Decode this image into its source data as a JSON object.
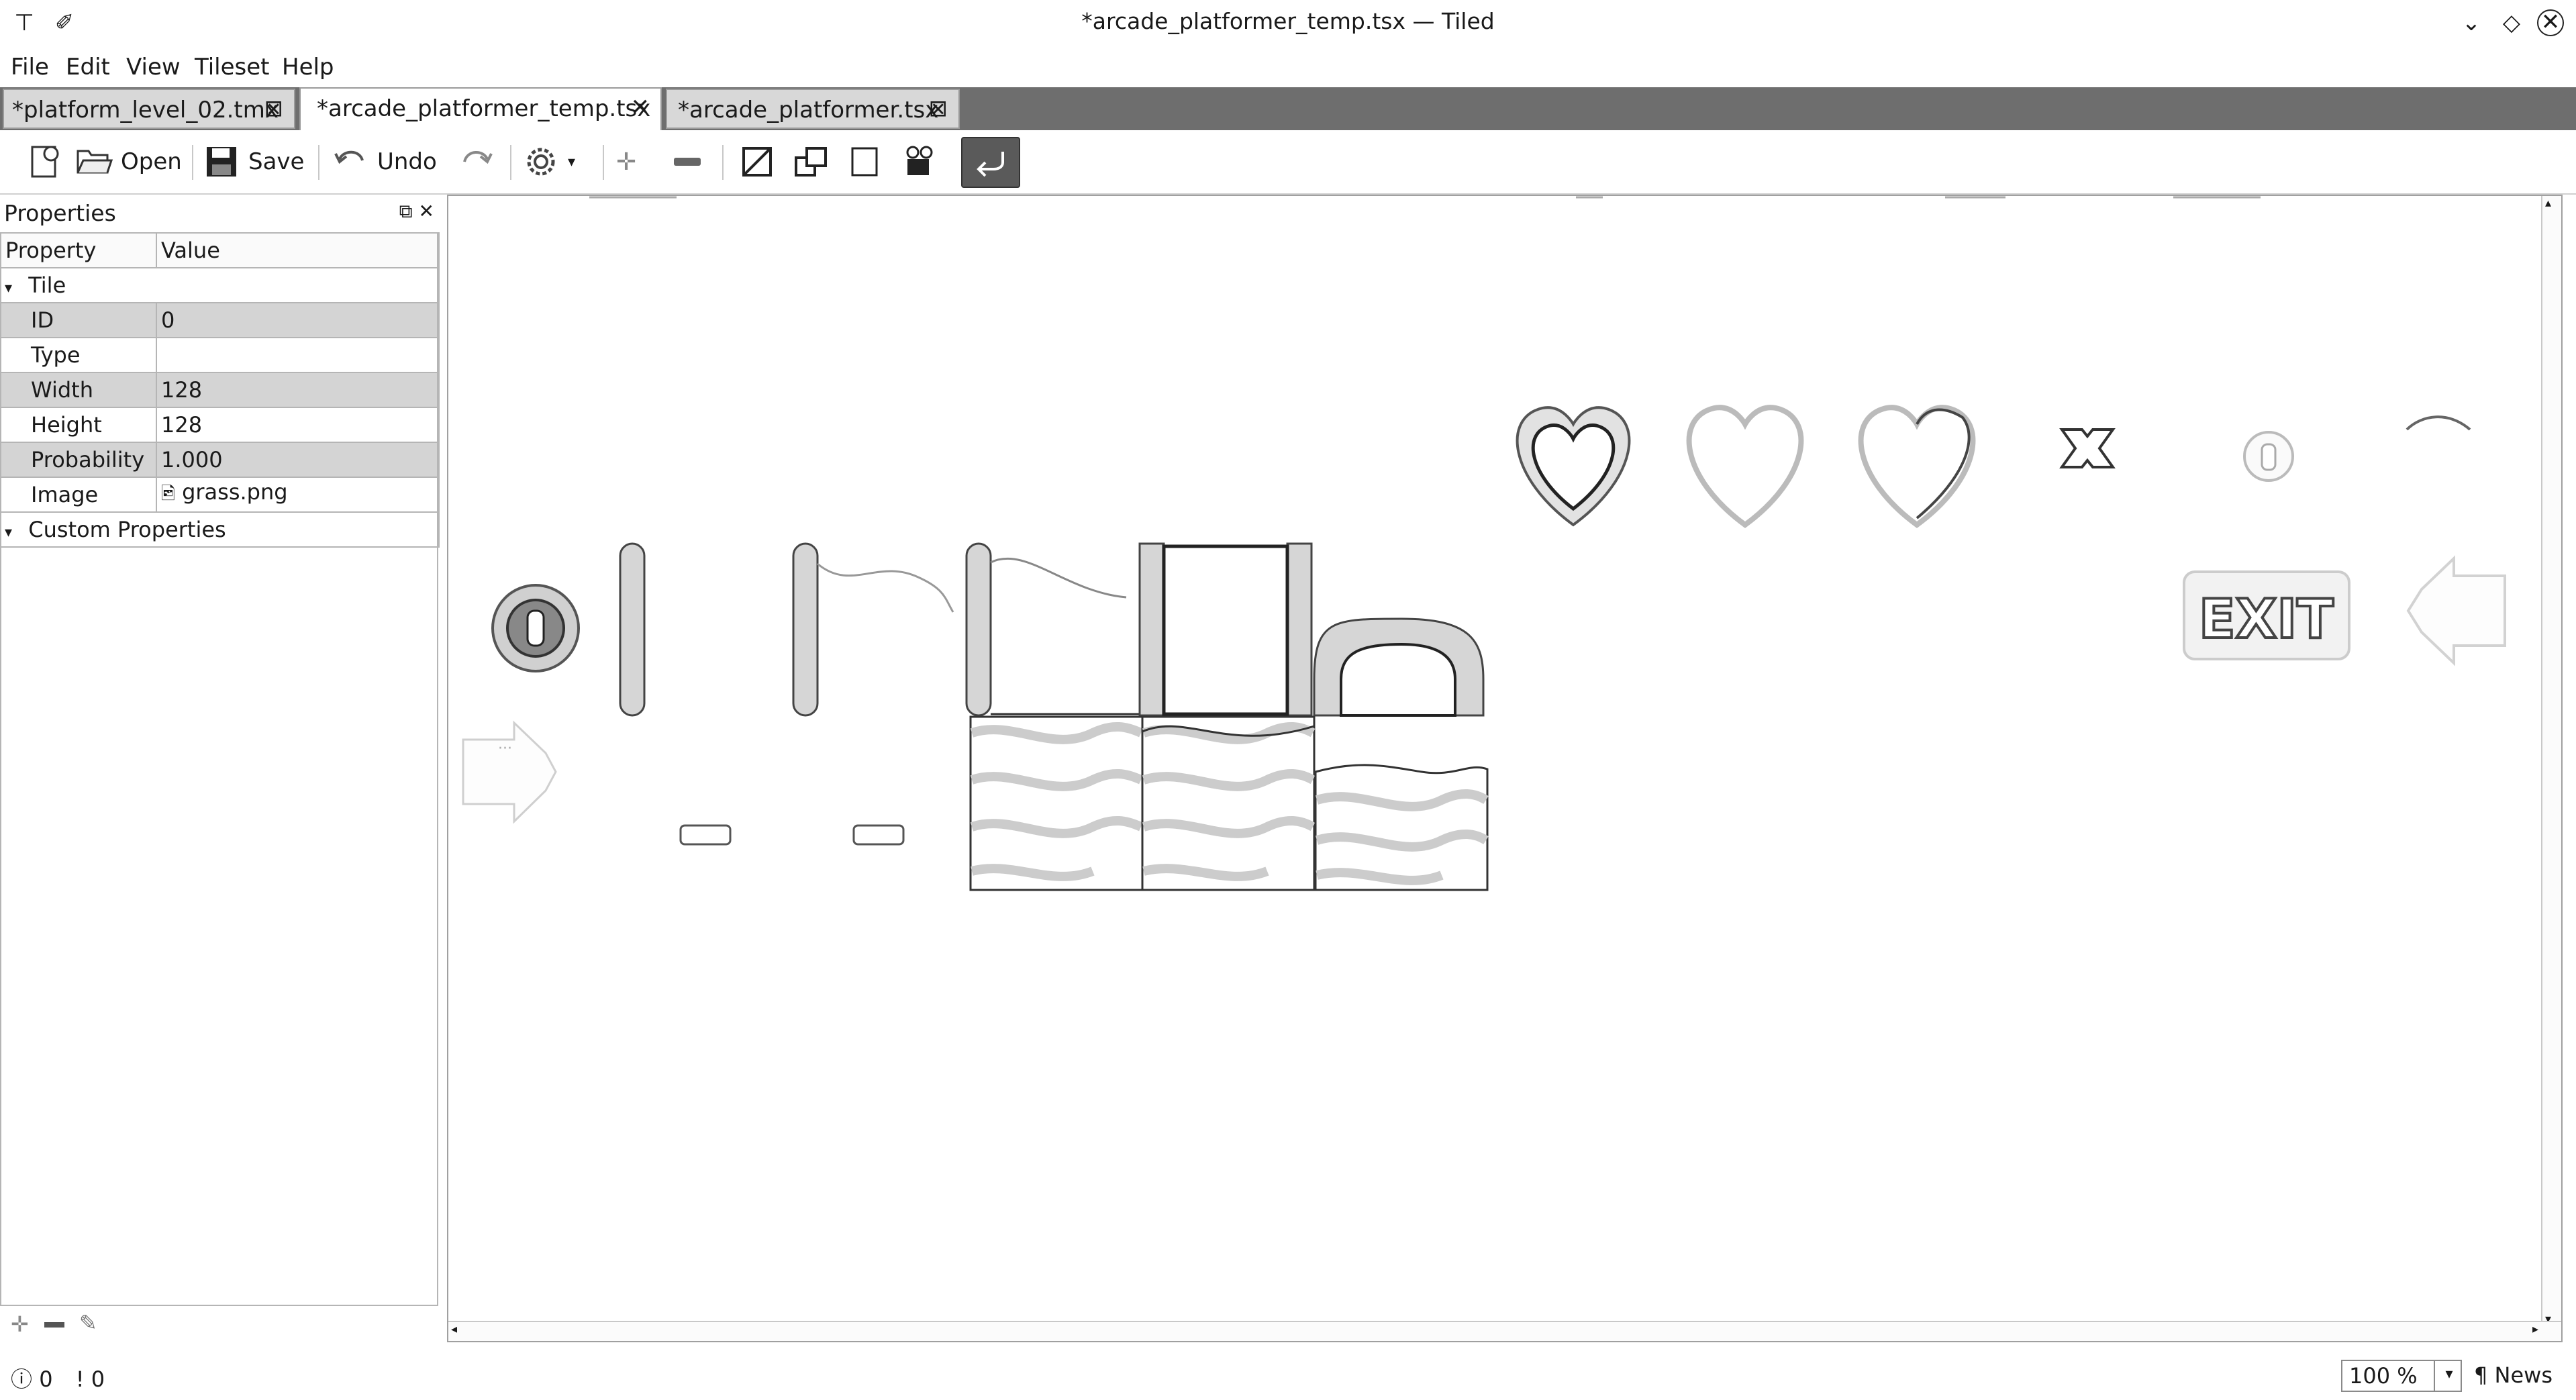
{
  "window": {
    "title": "*arcade_platformer_temp.tsx — Tiled"
  },
  "menu": [
    "File",
    "Edit",
    "View",
    "Tileset",
    "Help"
  ],
  "tabs": [
    {
      "label": "*platform_level_02.tmx",
      "active": false
    },
    {
      "label": "*arcade_platformer_temp.tsx",
      "active": true
    },
    {
      "label": "*arcade_platformer.tsx",
      "active": false
    }
  ],
  "toolbar": {
    "open_label": "Open",
    "save_label": "Save",
    "undo_label": "Undo"
  },
  "properties": {
    "title": "Properties",
    "col_property": "Property",
    "col_value": "Value",
    "group_tile": "Tile",
    "rows": [
      {
        "key": "ID",
        "value": "0"
      },
      {
        "key": "Type",
        "value": ""
      },
      {
        "key": "Width",
        "value": "128"
      },
      {
        "key": "Height",
        "value": "128"
      },
      {
        "key": "Probability",
        "value": "1.000"
      },
      {
        "key": "Image",
        "value": "grass.png"
      }
    ],
    "group_custom": "Custom Properties"
  },
  "tileset": {
    "exit_text": "EXIT"
  },
  "status": {
    "errors": "0",
    "warnings": "0",
    "zoom": "100 %",
    "news": "News"
  },
  "colors": {
    "active_tool": "#5a5a5a",
    "tab_bar": "#6e6e6e",
    "grid_row": "#d4d4d4"
  }
}
